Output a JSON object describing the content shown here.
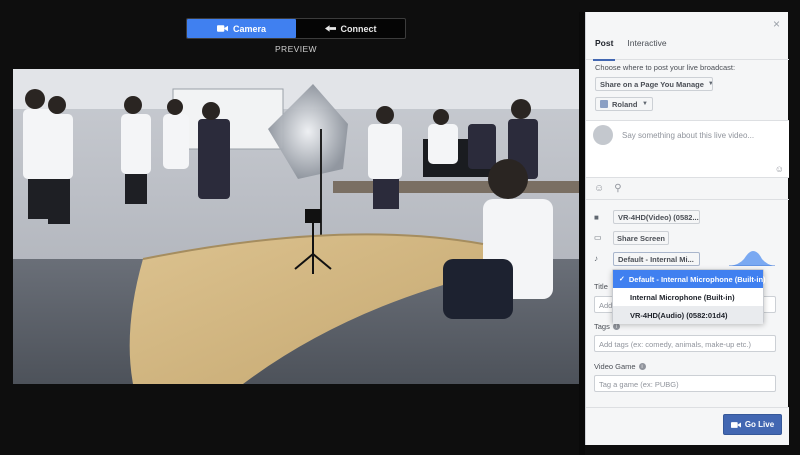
{
  "mode_toggle": {
    "camera_label": "Camera",
    "connect_label": "Connect",
    "preview_label": "PREVIEW"
  },
  "panel": {
    "close_glyph": "×",
    "tabs": [
      {
        "label": "Post",
        "active": true
      },
      {
        "label": "Interactive",
        "active": false
      }
    ],
    "where_label": "Choose where to post your live broadcast:",
    "post_target": "Share on a Page You Manage",
    "page_name": "Roland",
    "composer_placeholder": "Say something about this live video...",
    "video_source": "VR-4HD(Video) (0582...",
    "share_screen_label": "Share Screen",
    "audio_source": "Default - Internal Mi...",
    "audio_options": [
      {
        "label": "Default - Internal Microphone (Built-in)",
        "selected": true
      },
      {
        "label": "Internal Microphone (Built-in)",
        "selected": false
      },
      {
        "label": "VR-4HD(Audio) (0582:01d4)",
        "selected": false
      }
    ],
    "title_label": "Title",
    "title_placeholder": "Add",
    "tags_label": "Tags",
    "tags_placeholder": "Add tags (ex: comedy, animals, make-up etc.)",
    "game_label": "Video Game",
    "game_placeholder": "Tag a game (ex: PUBG)",
    "go_live_label": "Go Live"
  },
  "icons": {
    "camera": "camera-icon",
    "connect": "connect-icon",
    "video_source": "video-camera-icon",
    "screen": "monitor-icon",
    "mic": "microphone-icon",
    "emoji": "emoji-icon",
    "location": "location-pin-icon",
    "info": "info-icon"
  },
  "colors": {
    "accent": "#4080f0",
    "go_live": "#4267b2",
    "panel_bg": "#f5f6f7"
  }
}
